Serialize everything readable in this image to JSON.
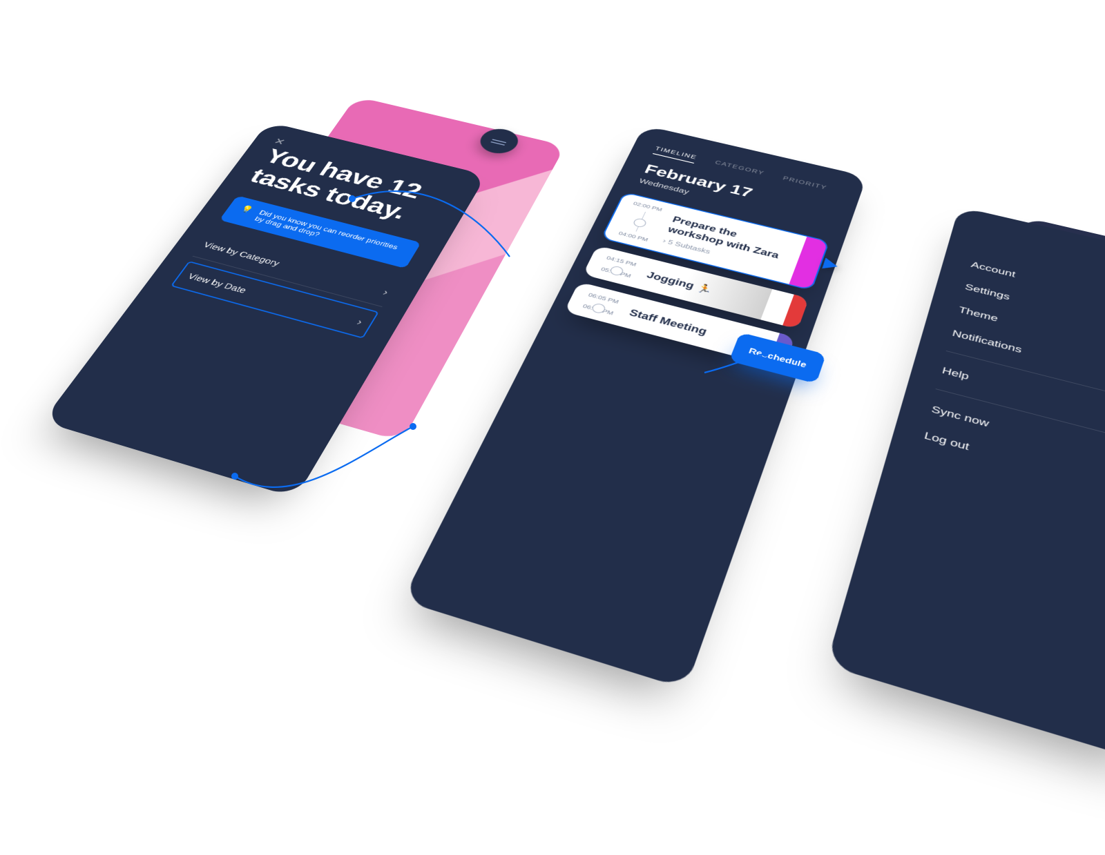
{
  "colors": {
    "navy": "#222e4a",
    "blue": "#0b6bf0",
    "magenta": "#e22fe2",
    "red": "#e33a3a"
  },
  "left_panel": {
    "hero": "You have 12 tasks today.",
    "tip": "Did you know you can reorder priorities by drag and drop?",
    "view_category": "View by Category",
    "view_date": "View by Date"
  },
  "center_panel": {
    "tabs": {
      "timeline": "TIMELINE",
      "category": "CATEGORY",
      "priority": "PRIORITY"
    },
    "date_title": "February 17",
    "date_sub": "Wednesday",
    "cards": [
      {
        "start": "02:00 PM",
        "end": "04:00 PM",
        "title": "Prepare the workshop with Zara",
        "sub": "5 Subtasks"
      },
      {
        "start": "04:15 PM",
        "end": "05:00 PM",
        "title": "Jogging 🏃",
        "sub": ""
      },
      {
        "start": "06:05 PM",
        "end": "06:30 PM",
        "title": "Staff Meeting",
        "sub": ""
      }
    ],
    "reschedule": "Reschedule"
  },
  "right_panel": {
    "items_a": [
      "Account",
      "Settings",
      "Theme",
      "Notifications"
    ],
    "items_b": [
      "Help"
    ],
    "items_c": [
      "Sync now",
      "Log out"
    ]
  }
}
